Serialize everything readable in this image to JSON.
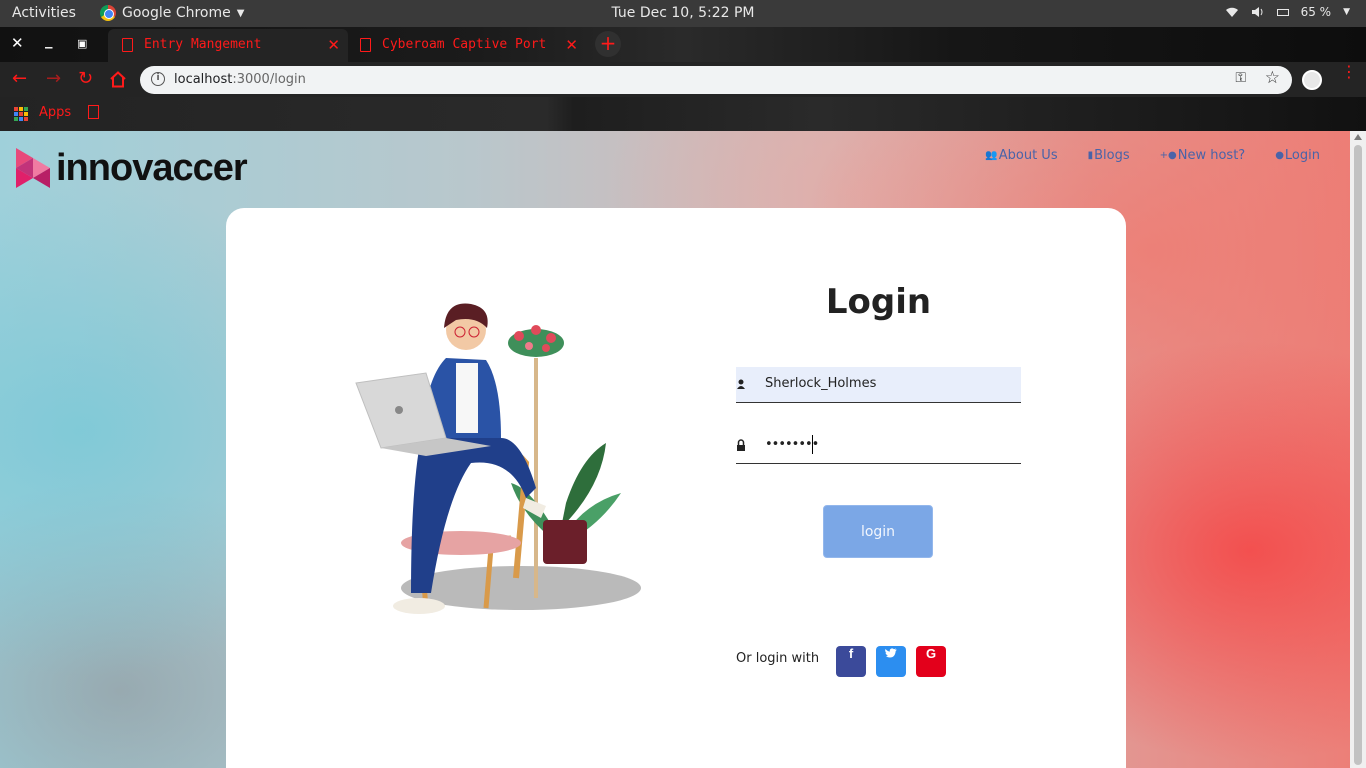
{
  "system_bar": {
    "activities": "Activities",
    "app_name": "Google Chrome",
    "clock": "Tue Dec 10,  5:22 PM",
    "battery": "65 %"
  },
  "browser": {
    "tabs": [
      {
        "title": "Entry Mangement",
        "active": true
      },
      {
        "title": "Cyberoam Captive Port",
        "active": false
      }
    ],
    "url_host": "localhost",
    "url_path": ":3000/login",
    "bookmarks": {
      "apps_label": "Apps"
    },
    "accent_color": "#ff1a1a"
  },
  "site": {
    "brand": "innovaccer",
    "nav": [
      {
        "icon": "users-icon",
        "label": "About Us"
      },
      {
        "icon": "bookmark-icon",
        "label": "Blogs"
      },
      {
        "icon": "user-plus-icon",
        "label": "New host?"
      },
      {
        "icon": "user-icon",
        "label": "Login"
      }
    ]
  },
  "login_form": {
    "title": "Login",
    "username_value": "Sherlock_Holmes",
    "password_mask": "••••••••",
    "submit_label": "login",
    "social_label": "Or login with",
    "social": [
      {
        "name": "facebook",
        "glyph": "f",
        "color": "#3b4a9a"
      },
      {
        "name": "twitter",
        "glyph": "t",
        "color": "#2c8ef0"
      },
      {
        "name": "google",
        "glyph": "G",
        "color": "#e3001b"
      }
    ]
  }
}
